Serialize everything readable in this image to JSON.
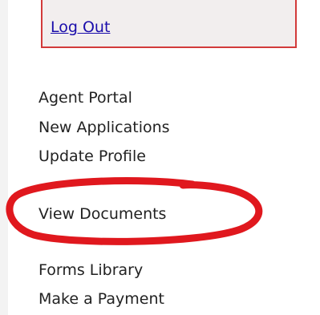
{
  "account": {
    "logout_label": "Log Out"
  },
  "nav": {
    "items": [
      {
        "label": "Agent Portal"
      },
      {
        "label": "New Applications"
      },
      {
        "label": "Update Profile"
      },
      {
        "label": "View Documents"
      },
      {
        "label": "Forms Library"
      },
      {
        "label": "Make a Payment"
      }
    ]
  },
  "annotation": {
    "highlight_color": "#e0181e",
    "highlighted_item": "View Documents"
  }
}
